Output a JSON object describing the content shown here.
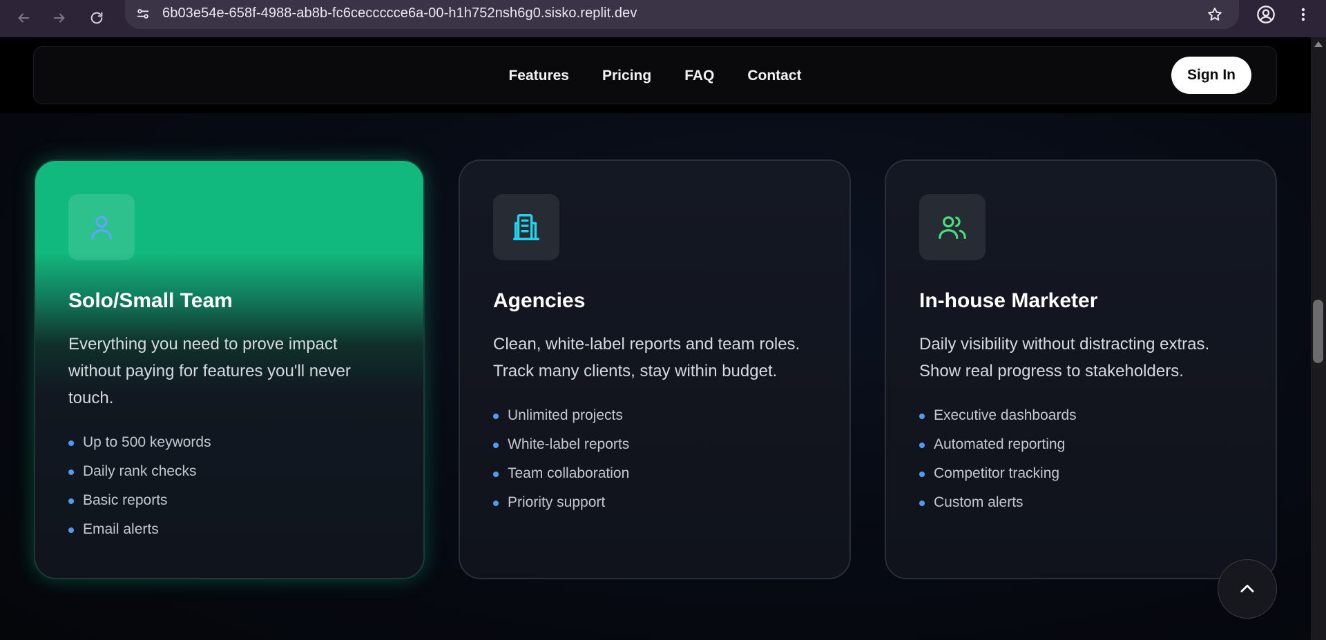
{
  "browser": {
    "url": "6b03e54e-658f-4988-ab8b-fc6ceccccce6a-00-h1h752nsh6g0.sisko.replit.dev",
    "back_icon": "arrow-left-icon",
    "forward_icon": "arrow-right-icon",
    "reload_icon": "reload-icon",
    "site_info_icon": "tune-icon",
    "bookmark_icon": "star-icon",
    "profile_icon": "account-icon",
    "menu_icon": "kebab-menu-icon"
  },
  "nav": {
    "links": [
      "Features",
      "Pricing",
      "FAQ",
      "Contact"
    ],
    "sign_in": "Sign In"
  },
  "cards": [
    {
      "icon": "user-icon",
      "icon_color": "#60a5fa",
      "title": "Solo/Small Team",
      "description": "Everything you need to prove impact without paying for features you'll never touch.",
      "features": [
        "Up to 500 keywords",
        "Daily rank checks",
        "Basic reports",
        "Email alerts"
      ],
      "highlight_color": "#10b981"
    },
    {
      "icon": "building-icon",
      "icon_color": "#22d3ee",
      "title": "Agencies",
      "description": "Clean, white-label reports and team roles. Track many clients, stay within budget.",
      "features": [
        "Unlimited projects",
        "White-label reports",
        "Team collaboration",
        "Priority support"
      ]
    },
    {
      "icon": "users-icon",
      "icon_color": "#4ade80",
      "title": "In-house Marketer",
      "description": "Daily visibility without distracting extras. Show real progress to stakeholders.",
      "features": [
        "Executive dashboards",
        "Automated reporting",
        "Competitor tracking",
        "Custom alerts"
      ]
    }
  ],
  "back_to_top_icon": "chevron-up-icon",
  "colors": {
    "bullet": "#4f9cf6",
    "page_bg": "#05070b"
  }
}
